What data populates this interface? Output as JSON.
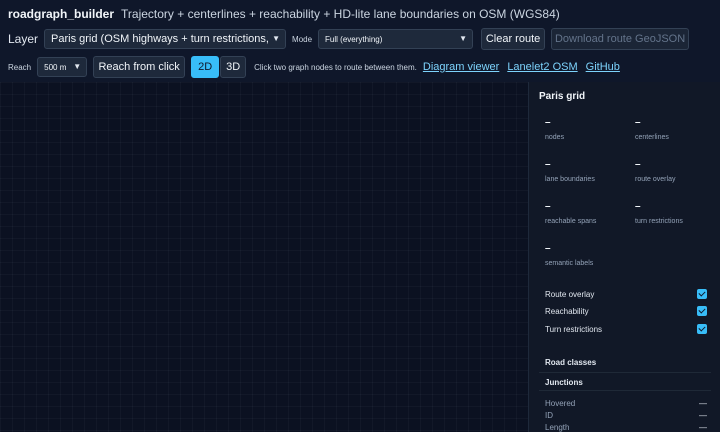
{
  "header": {
    "brand": "roadgraph_builder",
    "tagline": "Trajectory + centerlines + reachability + HD-lite lane boundaries on OSM (WGS84)"
  },
  "toolbar": {
    "layer_label": "Layer",
    "layer_value": "Paris grid (OSM highways + turn restrictions, HD-lite",
    "mode_label": "Mode",
    "mode_value": "Full (everything)",
    "clear_route": "Clear route",
    "download_route": "Download route GeoJSON",
    "reach_label": "Reach",
    "reach_value": "500 m",
    "reach_from_click": "Reach from click",
    "view_2d": "2D",
    "view_3d": "3D",
    "hint": "Click two graph nodes to route between them.",
    "links": [
      "Diagram viewer",
      "Lanelet2 OSM",
      "GitHub"
    ]
  },
  "panel": {
    "title": "Paris grid",
    "stats": [
      {
        "value": "–",
        "label": "nodes"
      },
      {
        "value": "–",
        "label": "centerlines"
      },
      {
        "value": "–",
        "label": "lane boundaries"
      },
      {
        "value": "–",
        "label": "route overlay"
      },
      {
        "value": "–",
        "label": "reachable spans"
      },
      {
        "value": "–",
        "label": "turn restrictions"
      },
      {
        "value": "–",
        "label": "semantic labels"
      }
    ],
    "toggles": [
      {
        "label": "Route overlay",
        "checked": true
      },
      {
        "label": "Reachability",
        "checked": true
      },
      {
        "label": "Turn restrictions",
        "checked": true
      }
    ],
    "road_classes_title": "Road classes",
    "junctions_title": "Junctions",
    "details": [
      {
        "key": "Hovered",
        "value": "—"
      },
      {
        "key": "ID",
        "value": "—"
      },
      {
        "key": "Length",
        "value": "—"
      }
    ]
  },
  "colors": {
    "accent": "#38bdf8",
    "background": "#0f172a",
    "link": "#7dd3fc"
  }
}
